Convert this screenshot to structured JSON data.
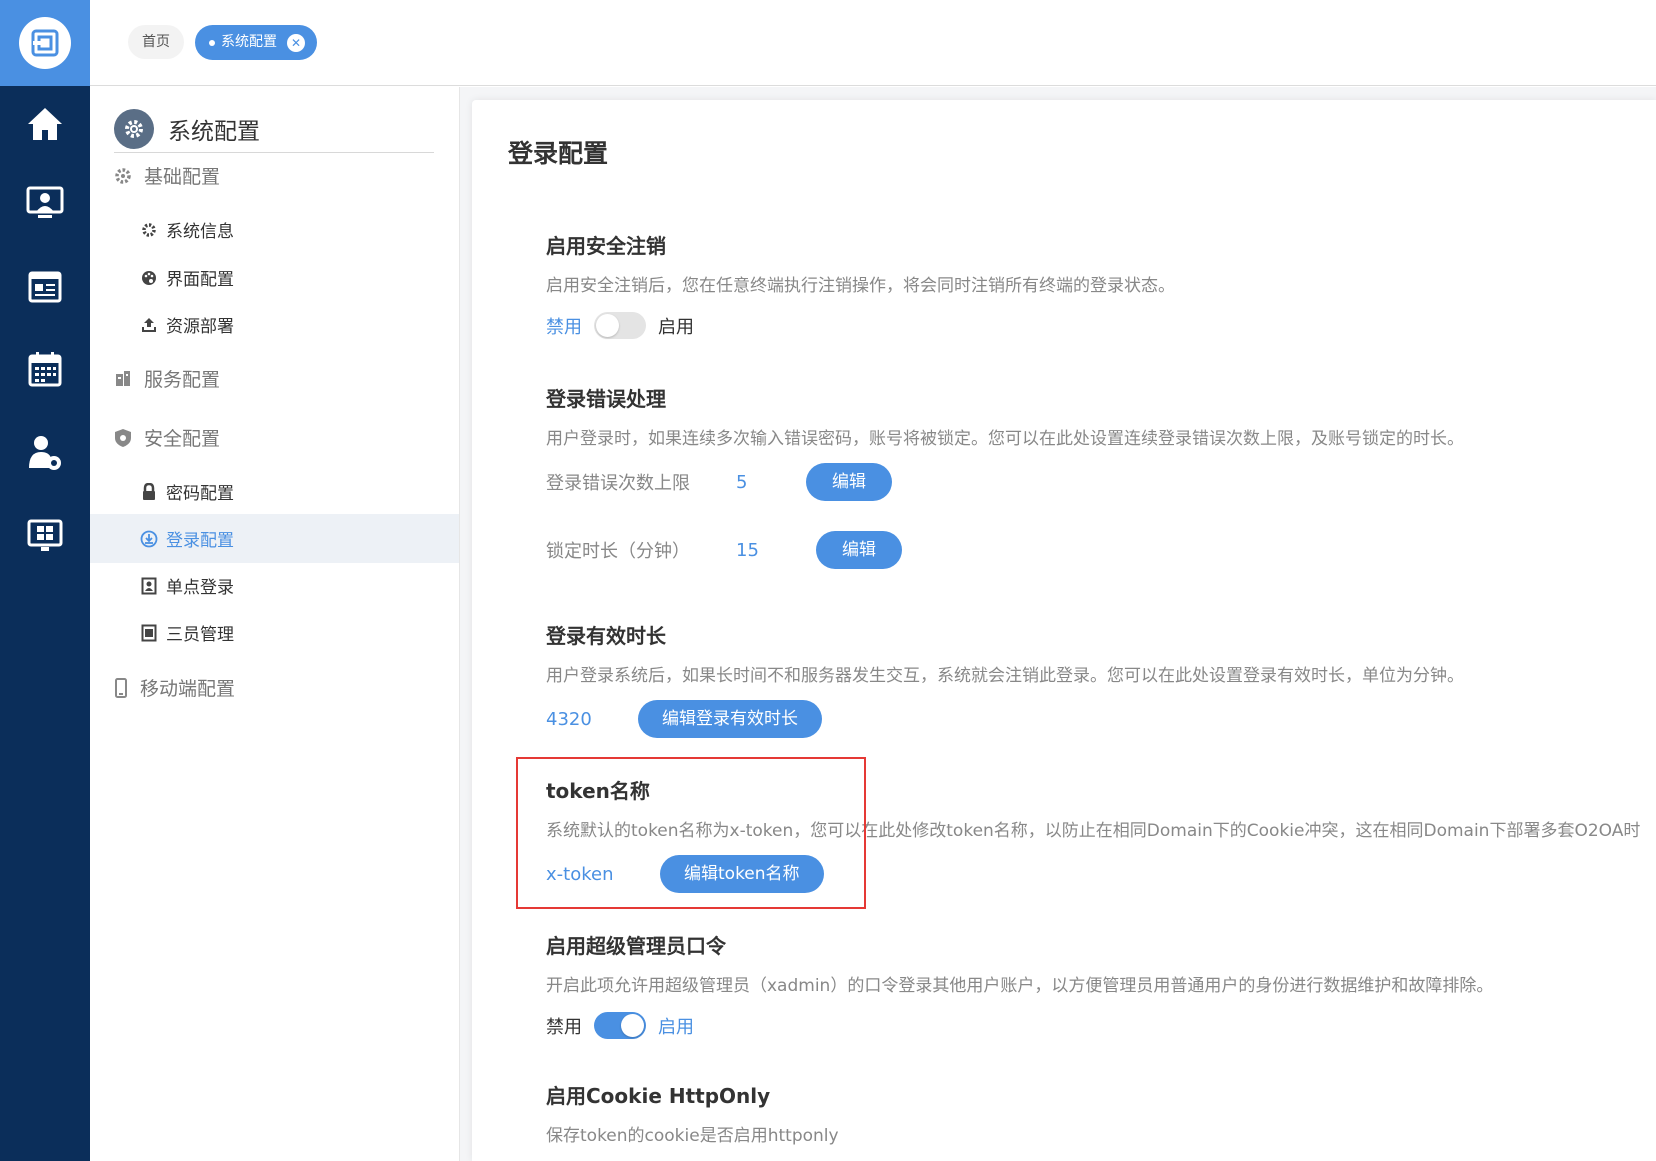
{
  "topbar": {
    "tabs": [
      {
        "label": "首页"
      },
      {
        "label": "系统配置"
      }
    ]
  },
  "rail": {
    "items": [
      "home-icon",
      "desktop-user-icon",
      "news-icon",
      "calendar-icon",
      "user-settings-icon",
      "dashboard-icon"
    ]
  },
  "submenu": {
    "title": "系统配置",
    "groups": {
      "basic": "基础配置",
      "service": "服务配置",
      "security": "安全配置",
      "mobile": "移动端配置"
    },
    "items": {
      "sysinfo": "系统信息",
      "ui": "界面配置",
      "deploy": "资源部署",
      "password": "密码配置",
      "login": "登录配置",
      "sso": "单点登录",
      "three": "三员管理"
    }
  },
  "main": {
    "title": "登录配置",
    "sections": {
      "safe_logout": {
        "title": "启用安全注销",
        "desc": "启用安全注销后，您在任意终端执行注销操作，将会同时注销所有终端的登录状态。",
        "off_label": "禁用",
        "on_label": "启用",
        "enabled": false
      },
      "login_error": {
        "title": "登录错误处理",
        "desc": "用户登录时，如果连续多次输入错误密码，账号将被锁定。您可以在此处设置连续登录错误次数上限，及账号锁定的时长。",
        "max_label": "登录错误次数上限",
        "max_value": "5",
        "lock_label": "锁定时长（分钟）",
        "lock_value": "15",
        "edit_label": "编辑"
      },
      "validity": {
        "title": "登录有效时长",
        "desc": "用户登录系统后，如果长时间不和服务器发生交互，系统就会注销此登录。您可以在此处设置登录有效时长，单位为分钟。",
        "value": "4320",
        "button": "编辑登录有效时长"
      },
      "token": {
        "title": "token名称",
        "desc": "系统默认的token名称为x-token，您可以在此处修改token名称，以防止在相同Domain下的Cookie冲突，这在相同Domain下部署多套O2OA时",
        "value": "x-token",
        "button": "编辑token名称"
      },
      "super_admin": {
        "title": "启用超级管理员口令",
        "desc": "开启此项允许用超级管理员（xadmin）的口令登录其他用户账户，以方便管理员用普通用户的身份进行数据维护和故障排除。",
        "off_label": "禁用",
        "on_label": "启用",
        "enabled": true
      },
      "httponly": {
        "title": "启用Cookie HttpOnly",
        "desc": "保存token的cookie是否启用httponly"
      }
    }
  }
}
